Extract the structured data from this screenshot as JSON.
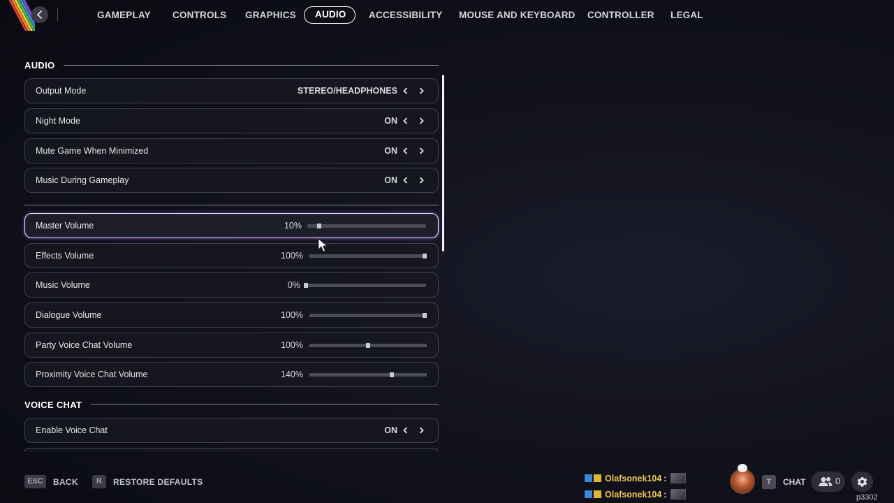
{
  "nav": {
    "tabs": [
      {
        "label": "GAMEPLAY"
      },
      {
        "label": "CONTROLS"
      },
      {
        "label": "GRAPHICS"
      },
      {
        "label": "AUDIO",
        "active": true
      },
      {
        "label": "ACCESSIBILITY"
      },
      {
        "label": "MOUSE AND KEYBOARD"
      },
      {
        "label": "CONTROLLER"
      },
      {
        "label": "LEGAL"
      }
    ]
  },
  "audio": {
    "title": "AUDIO",
    "toggles": [
      {
        "label": "Output Mode",
        "value": "STEREO/HEADPHONES"
      },
      {
        "label": "Night Mode",
        "value": "ON"
      },
      {
        "label": "Mute Game When Minimized",
        "value": "ON"
      },
      {
        "label": "Music During Gameplay",
        "value": "ON"
      }
    ],
    "sliders": [
      {
        "label": "Master Volume",
        "value_text": "10%",
        "fraction": 0.1,
        "focused": true
      },
      {
        "label": "Effects Volume",
        "value_text": "100%",
        "fraction": 1.0
      },
      {
        "label": "Music Volume",
        "value_text": "0%",
        "fraction": 0.0
      },
      {
        "label": "Dialogue Volume",
        "value_text": "100%",
        "fraction": 1.0
      },
      {
        "label": "Party Voice Chat Volume",
        "value_text": "100%",
        "fraction": 0.5
      },
      {
        "label": "Proximity Voice Chat Volume",
        "value_text": "140%",
        "fraction": 0.7
      }
    ]
  },
  "voice_chat": {
    "title": "VOICE CHAT",
    "toggles": [
      {
        "label": "Enable Voice Chat",
        "value": "ON"
      }
    ]
  },
  "footer": {
    "back_key": "ESC",
    "back_label": "BACK",
    "restore_key": "R",
    "restore_label": "RESTORE DEFAULTS"
  },
  "feed": [
    {
      "name": "Olafsonek104",
      "suffix": ":"
    },
    {
      "name": "Olafsonek104",
      "suffix": ":"
    }
  ],
  "social": {
    "chat_key": "T",
    "chat_label": "CHAT",
    "friends_count": "0",
    "build": "p3302"
  },
  "colors": {
    "accent_focus": "#e8e8f4",
    "feed_name": "#f0c75a"
  },
  "icons": [
    "back-arrow-icon",
    "chevron-left-icon",
    "chevron-right-icon",
    "friends-icon",
    "gear-icon",
    "mouse-cursor-icon",
    "crown-icon",
    "platform-icon"
  ]
}
